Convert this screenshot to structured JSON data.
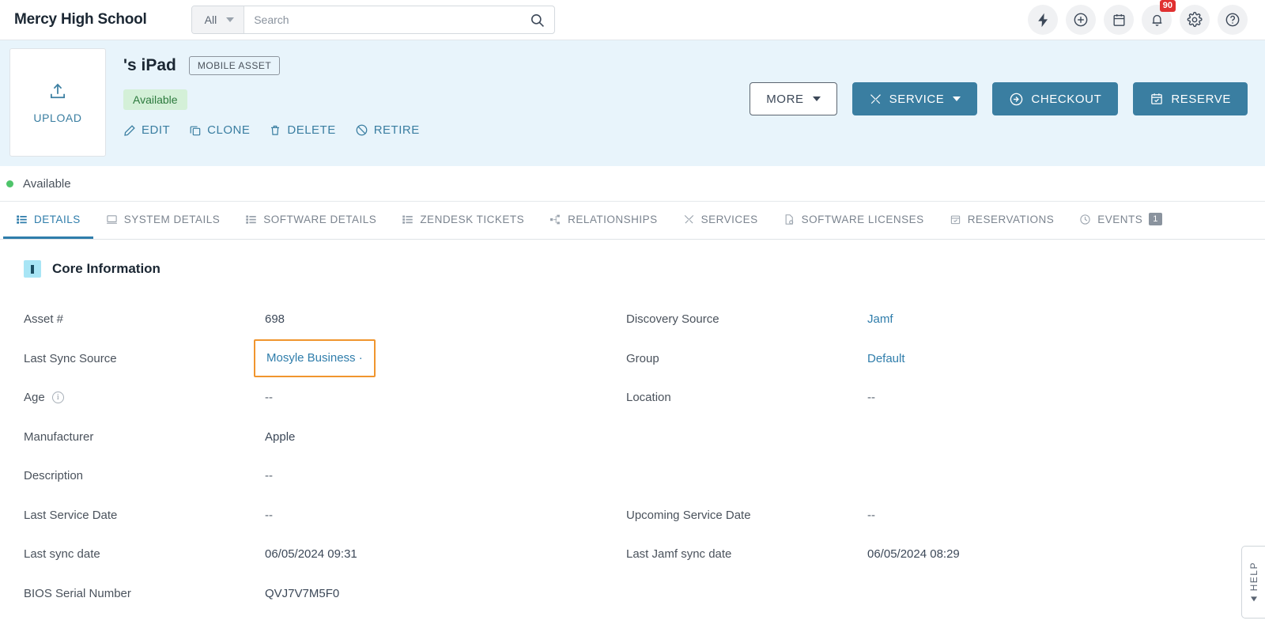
{
  "topbar": {
    "brand": "Mercy High School",
    "search": {
      "scope": "All",
      "placeholder": "Search",
      "value": ""
    },
    "icons": [
      {
        "name": "lightning-icon",
        "label": "Quick Actions"
      },
      {
        "name": "plus-circle-icon",
        "label": "Create"
      },
      {
        "name": "calendar-icon",
        "label": "Calendar"
      },
      {
        "name": "bell-icon",
        "label": "Notifications",
        "badge": "90"
      },
      {
        "name": "gear-icon",
        "label": "Settings"
      },
      {
        "name": "help-circle-icon",
        "label": "Help"
      }
    ]
  },
  "asset": {
    "upload_label": "UPLOAD",
    "title": "'s iPad",
    "type_badge": "MOBILE ASSET",
    "status_pill": "Available",
    "quick_actions": [
      {
        "label": "EDIT",
        "icon": "pencil-icon"
      },
      {
        "label": "CLONE",
        "icon": "copy-icon"
      },
      {
        "label": "DELETE",
        "icon": "trash-icon"
      },
      {
        "label": "RETIRE",
        "icon": "ban-icon"
      }
    ],
    "buttons": [
      {
        "label": "MORE",
        "style": "outline",
        "caret": true,
        "icon": ""
      },
      {
        "label": "SERVICE",
        "style": "primary",
        "caret": true,
        "icon": "tools-icon"
      },
      {
        "label": "CHECKOUT",
        "style": "primary",
        "caret": false,
        "icon": "arrow-circle-right-icon"
      },
      {
        "label": "RESERVE",
        "style": "primary",
        "caret": false,
        "icon": "calendar-check-icon"
      }
    ]
  },
  "status_row": {
    "text": "Available",
    "color": "#4ec46a"
  },
  "tabs": [
    {
      "label": "DETAILS",
      "icon": "list-icon",
      "active": true,
      "badge": ""
    },
    {
      "label": "SYSTEM DETAILS",
      "icon": "monitor-icon",
      "active": false,
      "badge": ""
    },
    {
      "label": "SOFTWARE DETAILS",
      "icon": "list-icon",
      "active": false,
      "badge": ""
    },
    {
      "label": "ZENDESK TICKETS",
      "icon": "list-icon",
      "active": false,
      "badge": ""
    },
    {
      "label": "RELATIONSHIPS",
      "icon": "sitemap-icon",
      "active": false,
      "badge": ""
    },
    {
      "label": "SERVICES",
      "icon": "tools-icon",
      "active": false,
      "badge": ""
    },
    {
      "label": "SOFTWARE LICENSES",
      "icon": "license-icon",
      "active": false,
      "badge": ""
    },
    {
      "label": "RESERVATIONS",
      "icon": "calendar-check-icon",
      "active": false,
      "badge": ""
    },
    {
      "label": "EVENTS",
      "icon": "clock-icon",
      "active": false,
      "badge": "1"
    }
  ],
  "section": {
    "title": "Core Information",
    "left_fields": [
      {
        "label": "Asset #",
        "value": "698",
        "type": "text",
        "info": false,
        "highlight": false
      },
      {
        "label": "Last Sync Source",
        "value": "Mosyle Business ·",
        "type": "link",
        "info": false,
        "highlight": true
      },
      {
        "label": "Age",
        "value": "--",
        "type": "muted",
        "info": true,
        "highlight": false
      },
      {
        "label": "Manufacturer",
        "value": "Apple",
        "type": "text",
        "info": false,
        "highlight": false
      },
      {
        "label": "Description",
        "value": "--",
        "type": "muted",
        "info": false,
        "highlight": false
      },
      {
        "label": "Last Service Date",
        "value": "--",
        "type": "muted",
        "info": false,
        "highlight": false
      },
      {
        "label": "Last sync date",
        "value": "06/05/2024 09:31",
        "type": "text",
        "info": false,
        "highlight": false
      },
      {
        "label": "BIOS Serial Number",
        "value": "QVJ7V7M5F0",
        "type": "text",
        "info": false,
        "highlight": false
      }
    ],
    "right_fields": [
      {
        "label": "Discovery Source",
        "value": "Jamf",
        "type": "link",
        "info": false,
        "highlight": false
      },
      {
        "label": "Group",
        "value": "Default",
        "type": "link",
        "info": false,
        "highlight": false
      },
      {
        "label": "Location",
        "value": "--",
        "type": "muted",
        "info": false,
        "highlight": false
      },
      {
        "label": "",
        "value": "",
        "type": "empty",
        "info": false,
        "highlight": false
      },
      {
        "label": "",
        "value": "",
        "type": "empty",
        "info": false,
        "highlight": false
      },
      {
        "label": "Upcoming Service Date",
        "value": "--",
        "type": "muted",
        "info": false,
        "highlight": false
      },
      {
        "label": "Last Jamf sync date",
        "value": "06/05/2024 08:29",
        "type": "text",
        "info": false,
        "highlight": false
      }
    ]
  },
  "help_tab": {
    "label": "HELP"
  },
  "colors": {
    "banner": "#e8f4fb",
    "primary": "#3a7ea1",
    "link": "#2f7dab",
    "highlight": "#f0952e",
    "status_green": "#4ec46a",
    "badge_red": "#e03030"
  }
}
